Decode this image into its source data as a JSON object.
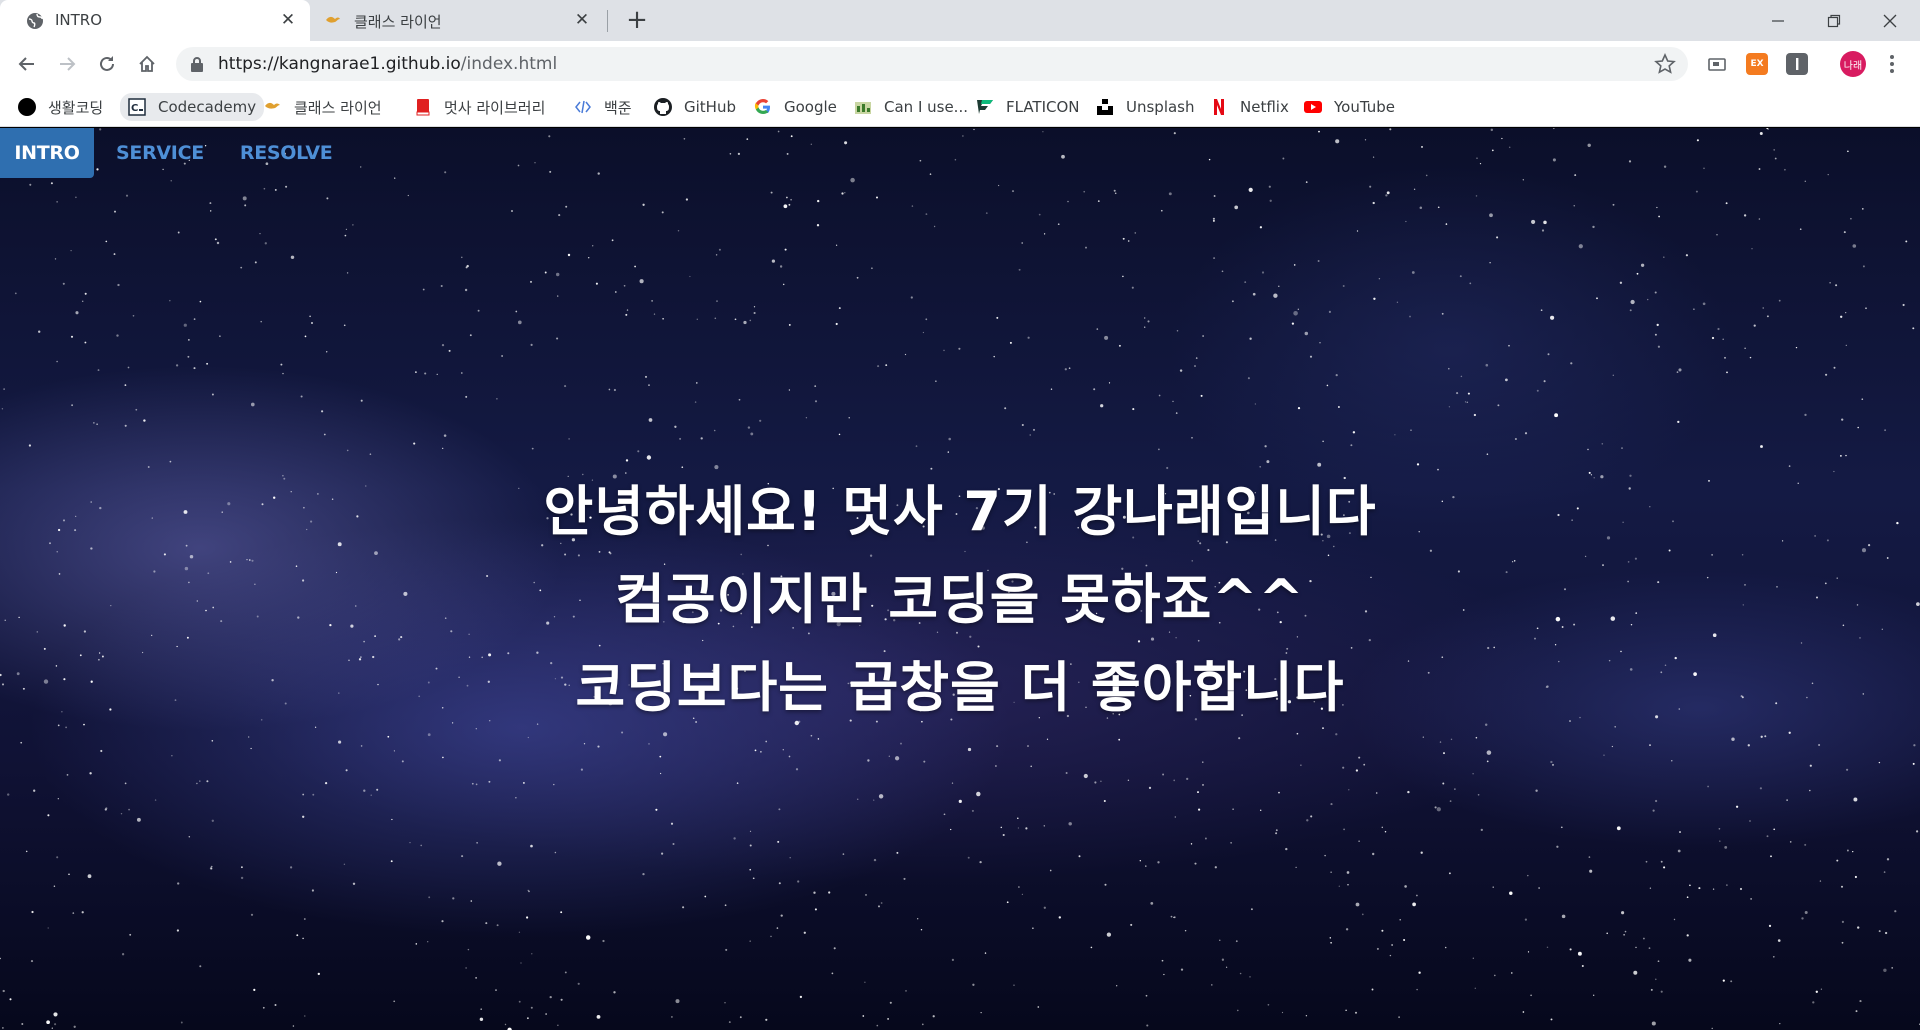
{
  "browser": {
    "tabs": [
      {
        "title": "INTRO",
        "active": true
      },
      {
        "title": "클래스 라이언",
        "active": false
      }
    ],
    "new_tab_icon": "plus-icon",
    "url_host": "https://kangnarae1.github.io",
    "url_path": "/index.html",
    "profile_initials": "나래",
    "ext_badge": "EX"
  },
  "bookmarks": [
    {
      "label": "생활코딩",
      "icon": "black-circle-icon"
    },
    {
      "label": "Codecademy",
      "icon": "codecademy-icon"
    },
    {
      "label": "클래스 라이언",
      "icon": "ryan-icon"
    },
    {
      "label": "멋사 라이브러리",
      "icon": "red-book-icon"
    },
    {
      "label": "백준",
      "icon": "code-brackets-icon"
    },
    {
      "label": "GitHub",
      "icon": "github-icon"
    },
    {
      "label": "Google",
      "icon": "google-icon"
    },
    {
      "label": "Can I use...",
      "icon": "caniuse-icon"
    },
    {
      "label": "FLATICON",
      "icon": "flaticon-icon"
    },
    {
      "label": "Unsplash",
      "icon": "unsplash-icon"
    },
    {
      "label": "Netflix",
      "icon": "netflix-icon"
    },
    {
      "label": "YouTube",
      "icon": "youtube-icon"
    }
  ],
  "nav": {
    "intro": "INTRO",
    "service": "SERVICE",
    "resolve": "RESOLVE"
  },
  "intro": {
    "line1": "안녕하세요! 멋사 7기 강나래입니다",
    "line2": "컴공이지만 코딩을 못하죠^^",
    "line3": "코딩보다는 곱창을 더 좋아합니다"
  },
  "colors": {
    "nav_active_bg": "#2f6fb0",
    "nav_link": "#4e8fd6",
    "text": "#ffffff"
  }
}
